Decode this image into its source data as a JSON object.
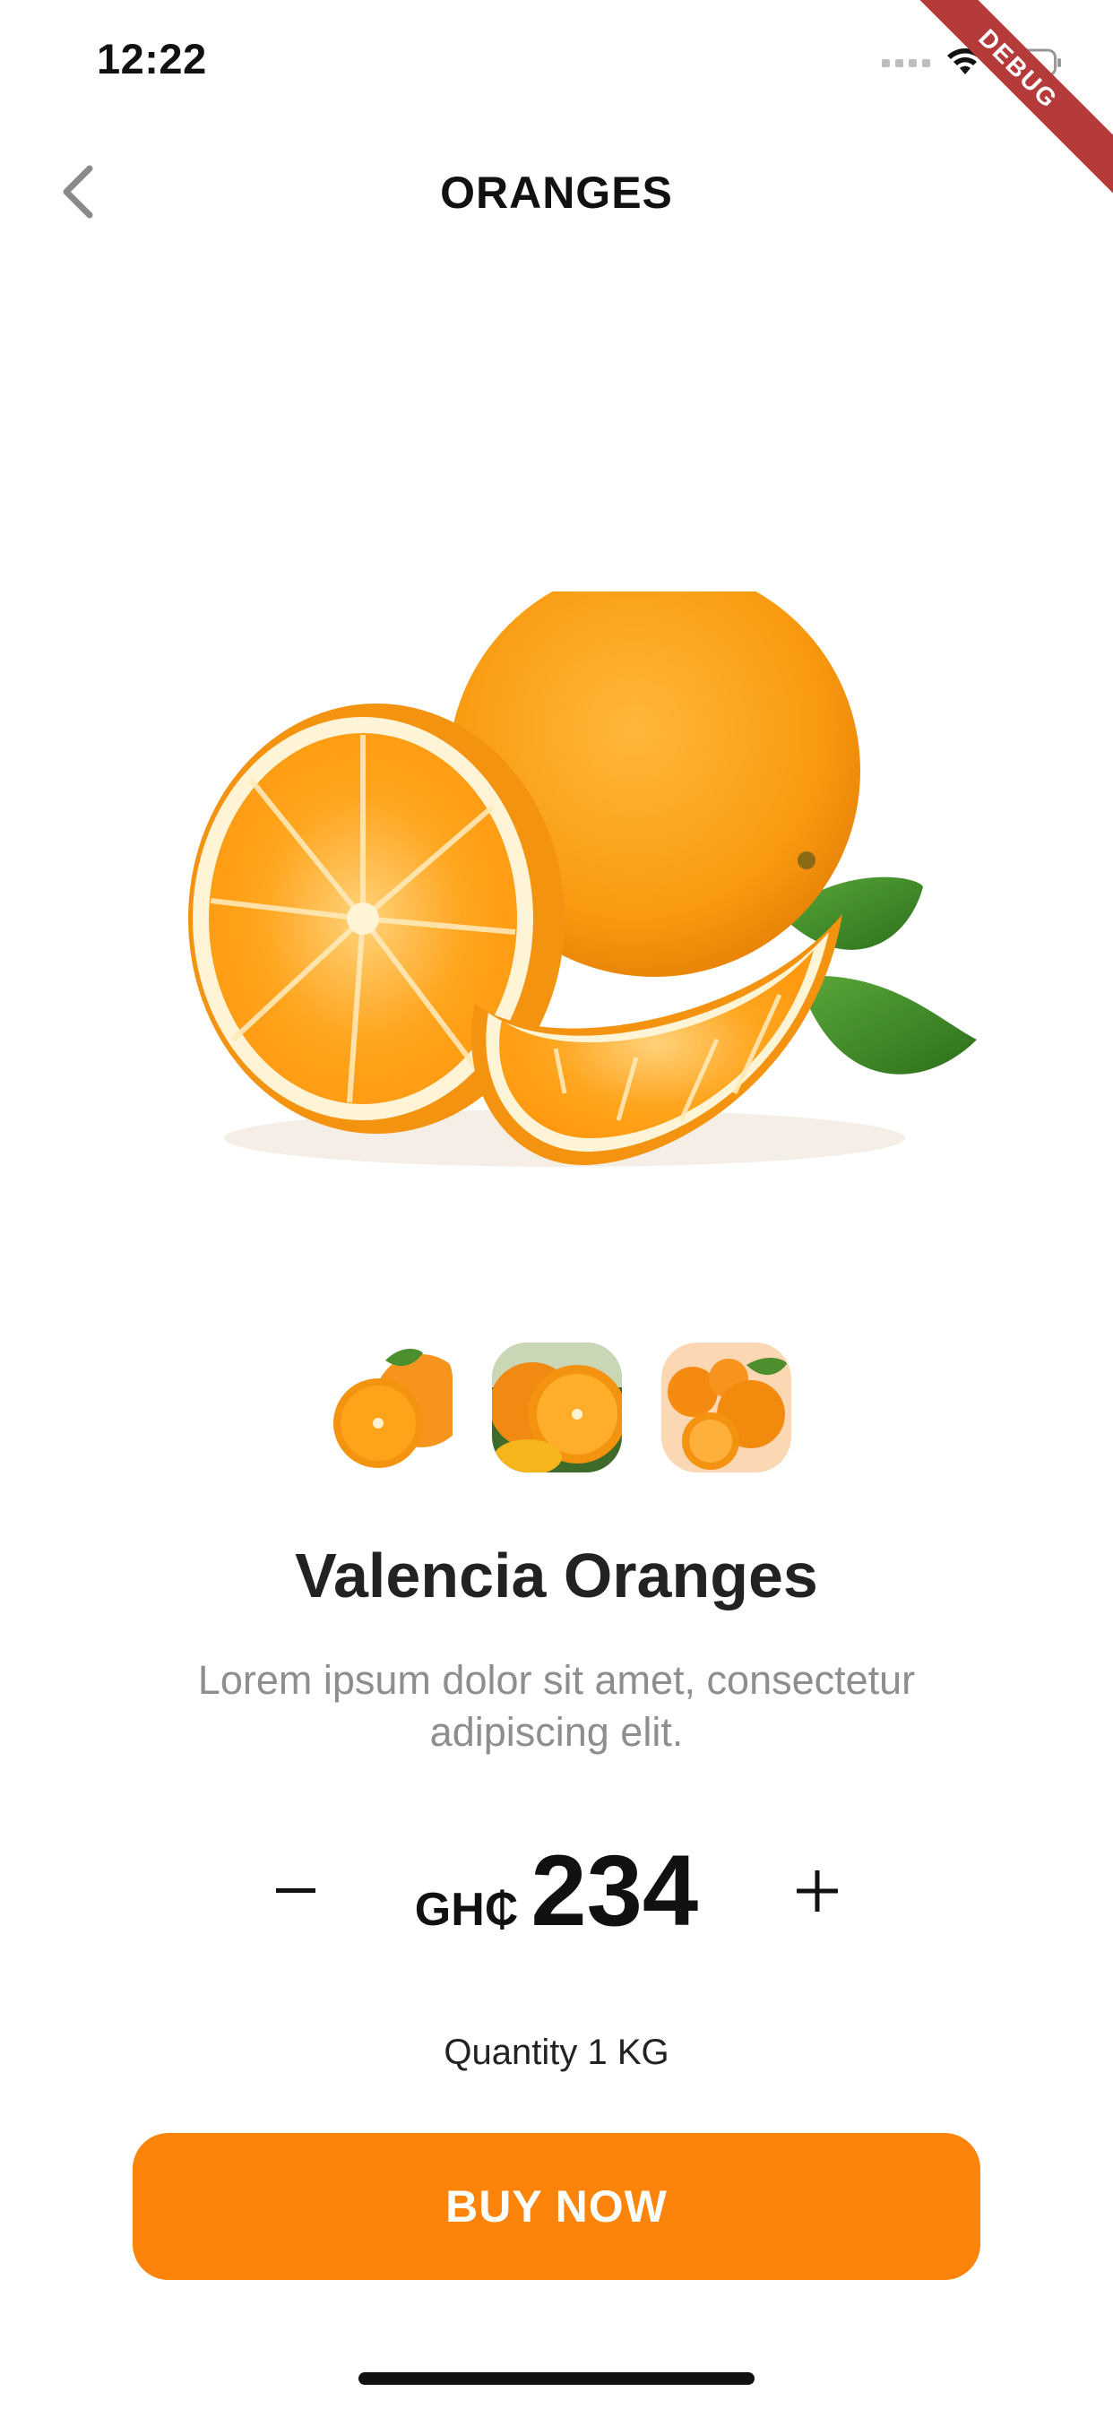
{
  "status_bar": {
    "time": "12:22",
    "icons": [
      "signal-dots-icon",
      "wifi-icon",
      "battery-icon"
    ]
  },
  "debug_banner": "DEBUG",
  "nav": {
    "back_icon": "chevron-left-icon",
    "title": "ORANGES"
  },
  "product": {
    "name": "Valencia Oranges",
    "description": "Lorem ipsum dolor sit amet, consectetur adipiscing elit.",
    "thumbnails": [
      "oranges-thumbnail",
      "oranges-thumbnail",
      "oranges-thumbnail"
    ],
    "currency": "GH₵",
    "price": "234",
    "quantity_label": "Quantity 1 KG"
  },
  "controls": {
    "decrement_label": "−",
    "increment_label": "+",
    "buy_label": "BUY NOW"
  },
  "colors": {
    "accent": "#fd840a",
    "debug_ribbon": "#b53a3a",
    "description_text": "#8e8e8e"
  }
}
